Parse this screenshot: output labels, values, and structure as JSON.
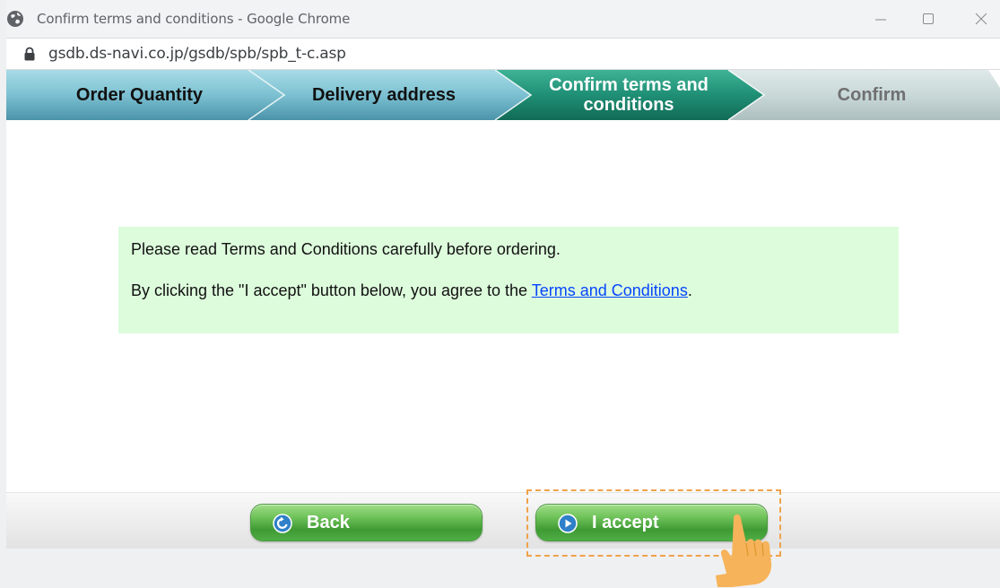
{
  "window": {
    "title": "Confirm terms and conditions - Google Chrome",
    "url": "gsdb.ds-navi.co.jp/gsdb/spb/spb_t-c.asp"
  },
  "steps": [
    {
      "label": "Order Quantity",
      "state": "done"
    },
    {
      "label": "Delivery address",
      "state": "done"
    },
    {
      "label": "Confirm terms and conditions",
      "state": "current"
    },
    {
      "label": "Confirm",
      "state": "upcoming"
    }
  ],
  "notice": {
    "line1": "Please read Terms and Conditions carefully before ordering.",
    "line2_prefix": "By clicking the \"I accept\" button below, you agree to the ",
    "link_text": "Terms and Conditions",
    "line2_suffix": "."
  },
  "buttons": {
    "back_label": "Back",
    "accept_label": "I accept"
  },
  "icons": {
    "window": "globe-icon",
    "address": "lock-icon",
    "back": "back-arrow-icon",
    "accept": "play-icon",
    "pointer": "hand-pointer-icon"
  },
  "colors": {
    "step_done": "#7fbfcf",
    "step_current": "#1f8f75",
    "step_upcoming": "#c9d8d8",
    "notice_bg": "#ddfcdc",
    "button_green": "#5cb84a",
    "highlight": "#f0a24a"
  }
}
